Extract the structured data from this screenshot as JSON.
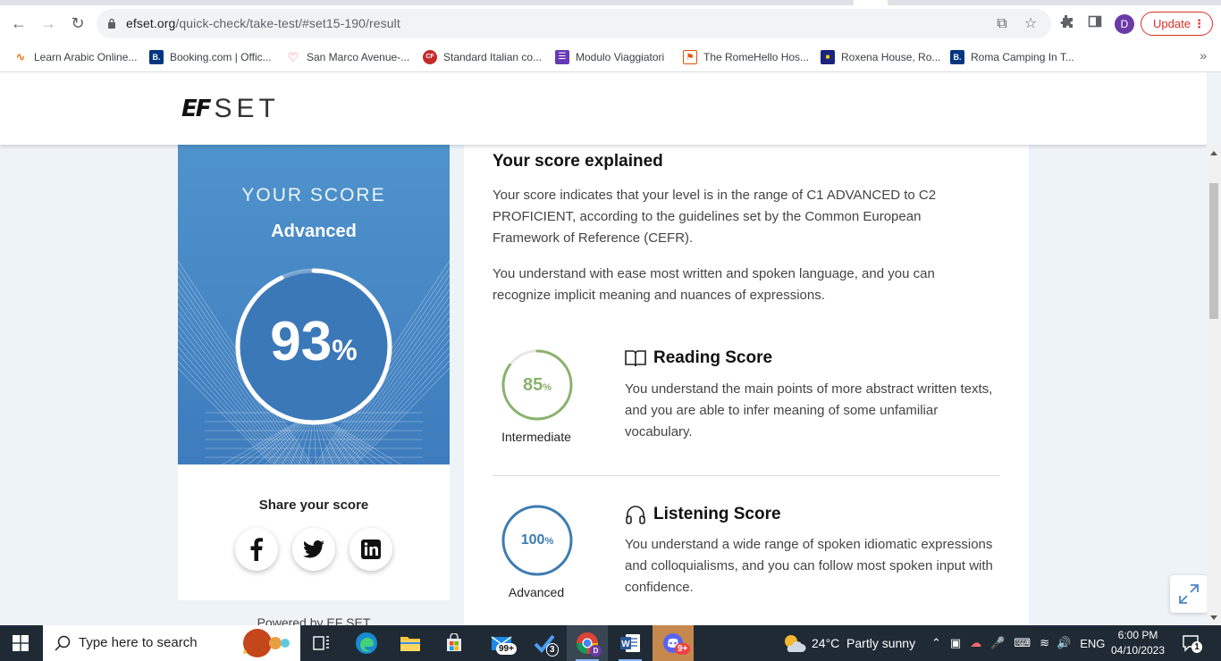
{
  "browser": {
    "url_host": "efset.org",
    "url_path": "/quick-check/take-test/#set15-190/result",
    "profile_initial": "D",
    "update_label": "Update",
    "bookmarks": [
      {
        "label": "Learn Arabic Online...",
        "icon": "arabic-icon",
        "color": "#e8710a"
      },
      {
        "label": "Booking.com | Offic...",
        "icon": "booking-icon",
        "color": "#003580"
      },
      {
        "label": "San Marco Avenue-...",
        "icon": "airbnb-icon",
        "color": "#ff5a5f"
      },
      {
        "label": "Standard Italian co...",
        "icon": "cf-icon",
        "color": "#c62828"
      },
      {
        "label": "Modulo Viaggiatori",
        "icon": "form-icon",
        "color": "#673ab7"
      },
      {
        "label": "The RomeHello Hos...",
        "icon": "hostel-icon",
        "color": "#e65100"
      },
      {
        "label": "Roxena House, Ro...",
        "icon": "roxena-icon",
        "color": "#1a237e"
      },
      {
        "label": "Roma Camping In T...",
        "icon": "booking-icon",
        "color": "#003580"
      }
    ]
  },
  "header": {
    "logo_mark": "EF",
    "logo_text": "SET"
  },
  "score": {
    "title": "YOUR SCORE",
    "level": "Advanced",
    "value": "93",
    "unit": "%",
    "percent": 93
  },
  "share": {
    "label": "Share your score",
    "networks": [
      "facebook",
      "twitter",
      "linkedin"
    ],
    "powered_by": "Powered by EF SET"
  },
  "explanation": {
    "title": "Your score explained",
    "para1": "Your score indicates that your level is in the range of C1 ADVANCED to C2 PROFICIENT, according to the guidelines set by the Common European Framework of Reference (CEFR).",
    "para2": "You understand with ease most written and spoken language, and you can recognize implicit meaning and nuances of expressions."
  },
  "skills": [
    {
      "name": "Reading Score",
      "value": "85",
      "unit": "%",
      "percent": 85,
      "level": "Intermediate",
      "color": "#8ab26d",
      "description": "You understand the main points of more abstract written texts, and you are able to infer meaning of some unfamiliar vocabulary."
    },
    {
      "name": "Listening Score",
      "value": "100",
      "unit": "%",
      "percent": 100,
      "level": "Advanced",
      "color": "#3e7cb1",
      "description": "You understand a wide range of spoken idiomatic expressions and colloquialisms, and you can follow most spoken input with confidence."
    }
  ],
  "taskbar": {
    "search_placeholder": "Type here to search",
    "mail_badge": "99+",
    "todo_badge": "3",
    "discord_badge": "9+",
    "weather": "24°C  Partly sunny",
    "language": "ENG",
    "time": "6:00 PM",
    "date": "04/10/2023",
    "notifications": "1"
  }
}
